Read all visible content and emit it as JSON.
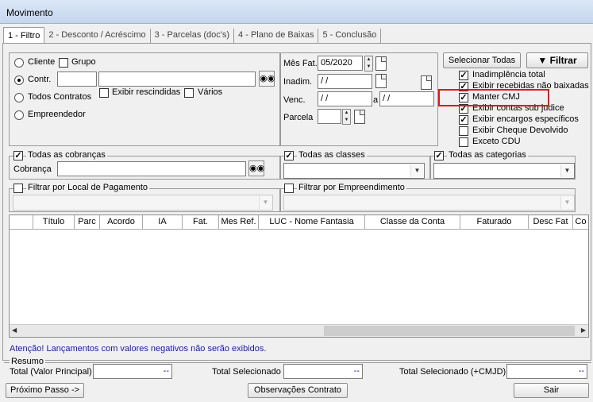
{
  "window": {
    "title": "Movimento"
  },
  "tabs": [
    "1 - Filtro",
    "2 - Desconto / Acréscimo",
    "3 - Parcelas (doc's)",
    "4 - Plano de Baixas",
    "5 - Conclusão"
  ],
  "left_panel": {
    "cliente": "Cliente",
    "grupo": "Grupo",
    "contr": "Contr.",
    "todos_contratos": "Todos Contratos",
    "exibir_rescindidas": "Exibir rescindidas",
    "varios": "Vários",
    "empreendedor": "Empreendedor"
  },
  "dates": {
    "mes_fat_label": "Mês Fat.",
    "mes_fat_value": "05/2020",
    "inadim_label": "Inadim.",
    "inadim_value": " / /",
    "venc_label": "Venc.",
    "venc_from": " / /",
    "venc_a": "a",
    "venc_to": " / /",
    "parcela_label": "Parcela"
  },
  "right_panel": {
    "selecionar_todas": "Selecionar Todas",
    "filtrar": "Filtrar",
    "options": [
      {
        "label": "Inadimplência total",
        "checked": true
      },
      {
        "label": "Exibir recebidas não baixadas",
        "checked": true
      },
      {
        "label": "Manter CMJ",
        "checked": true
      },
      {
        "label": "Exibir contas sub judice",
        "checked": true
      },
      {
        "label": "Exibir encargos específicos",
        "checked": true
      },
      {
        "label": "Exibir Cheque Devolvido",
        "checked": false
      },
      {
        "label": "Exceto CDU",
        "checked": false
      }
    ]
  },
  "filters": {
    "todas_cobrancas": "Todas as cobranças",
    "cobranca_label": "Cobrança",
    "todas_classes": "Todas as classes",
    "todas_categorias": "Todas as categorias",
    "filtrar_local": "Filtrar por Local de Pagamento",
    "filtrar_empreendimento": "Filtrar por Empreendimento"
  },
  "grid": {
    "columns": [
      "Título",
      "Parc",
      "Acordo",
      "IA",
      "Fat.",
      "Mes Ref.",
      "LUC - Nome Fantasia",
      "Classe da Conta",
      "Faturado",
      "Desc Fat",
      "Co"
    ]
  },
  "warning": "Atenção! Lançamentos com valores negativos não serão exibidos.",
  "resumo": {
    "title": "Resumo",
    "total_principal": "Total (Valor Principal)",
    "total_selecionado": "Total Selecionado",
    "total_selecionado_cmjd": "Total Selecionado (+CMJD)",
    "value_placeholder": "--"
  },
  "footer": {
    "proximo": "Próximo Passo ->",
    "observacoes": "Observações Contrato",
    "sair": "Sair"
  },
  "colors": {
    "warning_text": "#1a1aa8",
    "highlight": "#e0181f"
  }
}
